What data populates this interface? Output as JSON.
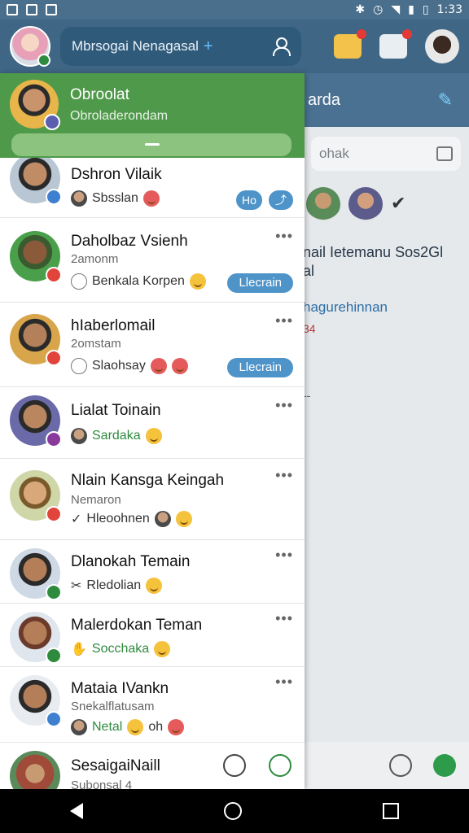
{
  "status_bar": {
    "time": "1:33"
  },
  "app_bar": {
    "search_text": "Mbrsogai Nenagasal",
    "plus": "+"
  },
  "right_panel": {
    "header_title": "arda",
    "search_placeholder": "ohak",
    "line1": "nail Ietemanu Sos2Gl",
    "line1b": "al",
    "line2": "hagurehinnan",
    "line3": "34",
    "line4": "--"
  },
  "drawer": {
    "header": {
      "title": "Obroolat",
      "subtitle": "Obroladerondam"
    },
    "chats": [
      {
        "name": "Dshron Vilaik",
        "sub": "",
        "last": "Sbsslan",
        "pill": "Ho"
      },
      {
        "name": "Daholbaz Vsienh",
        "sub": "2amonm",
        "last": "Benkala Korpen",
        "button": "Llecrain"
      },
      {
        "name": "hIaberlomail",
        "sub": "2omstam",
        "last": "Slaohsay",
        "button": "Llecrain"
      },
      {
        "name": "Lialat Toinain",
        "sub": "",
        "last": "Sardaka"
      },
      {
        "name": "Nlain Kansga Keingah",
        "sub": "Nemaron",
        "last": "Hleoohnen"
      },
      {
        "name": "Dlanokah Temain",
        "sub": "",
        "last": "Rledolian"
      },
      {
        "name": "Malerdokan Teman",
        "sub": "",
        "last": "Socchaka"
      },
      {
        "name": "Mataia IVankn",
        "sub": "Snekalflatusam",
        "last": "Netal",
        "last2": "oh"
      }
    ],
    "bottom": {
      "name": "SesaigaiNaill",
      "sub": "Subonsal 4"
    }
  },
  "colors": {
    "app_bar": "#3f6685",
    "drawer_header": "#4f9a4a",
    "accent_button": "#4e94c9"
  }
}
